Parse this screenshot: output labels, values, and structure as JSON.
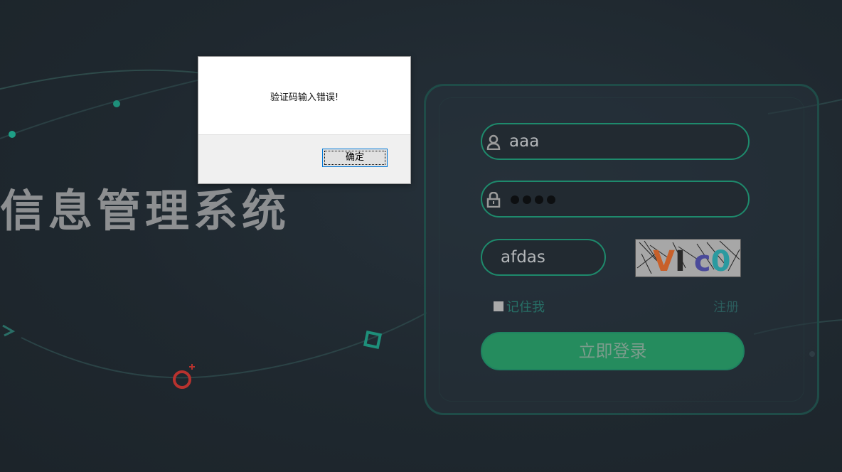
{
  "background": {
    "system_title": "信息管理系统"
  },
  "login": {
    "username_value": "aaa",
    "password_dot_count": 4,
    "captcha_value": "afdas",
    "captcha_image_text": "VI c0",
    "remember_label": "记住我",
    "register_label": "注册",
    "submit_label": "立即登录"
  },
  "dialog": {
    "message": "验证码输入错误!",
    "ok_label": "确定"
  },
  "colors": {
    "accent_green": "#258c5e",
    "field_border": "#1e8a6c",
    "background": "#1f282f"
  },
  "icons": {
    "username": "user-icon",
    "password": "lock-icon"
  }
}
